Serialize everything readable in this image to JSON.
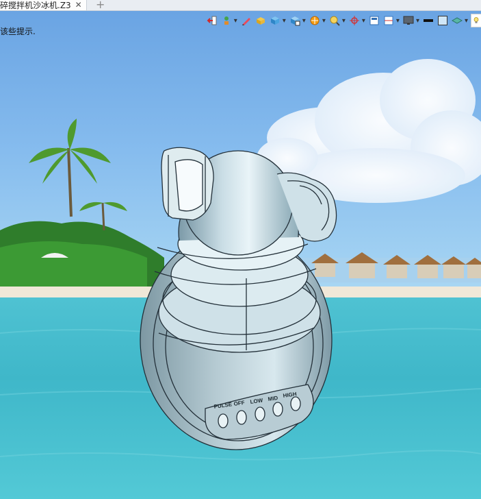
{
  "tab": {
    "title": "碎搅拌机沙冰机.Z3",
    "close_label": "✕",
    "new_tab_label": "+"
  },
  "hint": {
    "text": "该些提示."
  },
  "model": {
    "button_labels": [
      "PULSE",
      "OFF",
      "LOW",
      "MID",
      "HIGH"
    ]
  },
  "toolbar": {
    "icons": [
      "exit-icon",
      "plant-icon",
      "pencil-icon",
      "solid-box-icon",
      "cube-icon",
      "cube-view-icon",
      "render-icon",
      "zoom-icon",
      "axis-icon",
      "window-icon",
      "split-icon",
      "monitor-icon",
      "black-line-icon",
      "square-icon",
      "layer-icon",
      "light-bulb-icon"
    ]
  }
}
